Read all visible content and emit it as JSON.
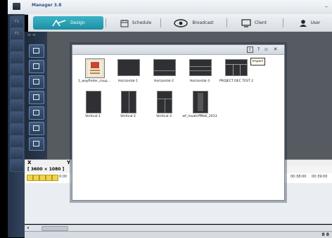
{
  "window": {
    "title": "Manager 3.8",
    "minimize_glyph": "–"
  },
  "nav": {
    "design": "Design",
    "schedule": "Schedule",
    "broadcast": "Broadcast",
    "client": "Client",
    "user": "User"
  },
  "left_tools": [
    "F1",
    "F1",
    "",
    "",
    "",
    "",
    "",
    "",
    "",
    "",
    "",
    "",
    ""
  ],
  "tools2_header": "≪ ≪",
  "timeline_head": {
    "x": "X",
    "y": "Y"
  },
  "resolution": "[ 3600 × 1080 ]",
  "timeline": {
    "start_time": "0:00",
    "time_a": "00:38:00",
    "time_b": "00:39:00"
  },
  "hscroll": {
    "left_arrow": "◂",
    "thumb_text": "m"
  },
  "status_grip": "8 8",
  "dialog": {
    "buttons": {
      "import": "⇪",
      "help": "?",
      "restore": "▫",
      "close": "✕"
    },
    "tooltip": "Import",
    "items": [
      {
        "caption": "1_wayfinder_coup...",
        "kind": "poster"
      },
      {
        "caption": "Horizontal-1",
        "kind": "h1"
      },
      {
        "caption": "Horizontal-2",
        "kind": "h2"
      },
      {
        "caption": "Horizontal-3",
        "kind": "h3"
      },
      {
        "caption": "PROJECT DEC TEST 2",
        "kind": "project"
      },
      {
        "caption": "Vertical-1",
        "kind": "v1"
      },
      {
        "caption": "Vertical-2",
        "kind": "v2"
      },
      {
        "caption": "Vertical-3",
        "kind": "v3"
      },
      {
        "caption": "wf_muahrffMall_2013",
        "kind": "wf"
      }
    ]
  },
  "colors": {
    "accent": "#1b8fa2",
    "canvas": "#565b61",
    "toolbar_dark": "#243247"
  },
  "icons": {
    "design": "design-logo-icon",
    "schedule": "calendar-icon",
    "broadcast": "broadcast-icon",
    "client": "monitor-icon",
    "user": "user-icon"
  }
}
